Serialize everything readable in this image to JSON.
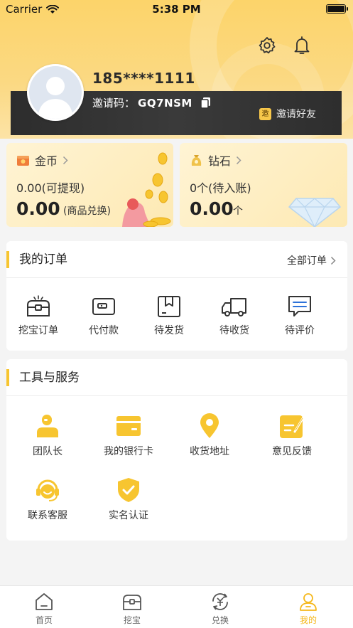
{
  "status_bar": {
    "carrier": "Carrier",
    "time": "5:38 PM"
  },
  "profile": {
    "phone": "185****1111",
    "invite_code_label": "邀请码：",
    "invite_code": "GQ7NSM",
    "invite_friends_badge": "邀",
    "invite_friends": "邀请好友"
  },
  "wallet": {
    "coins": {
      "title": "金币",
      "withdrawable": "0.00(可提现)",
      "amount": "0.00",
      "note": "(商品兑换)"
    },
    "diamonds": {
      "title": "钻石",
      "pending": "0个(待入账)",
      "amount": "0.00",
      "unit": "个"
    }
  },
  "orders": {
    "title": "我的订单",
    "all_label": "全部订单",
    "items": [
      {
        "label": "挖宝订单",
        "icon": "treasure-box-icon"
      },
      {
        "label": "代付款",
        "icon": "wallet-icon"
      },
      {
        "label": "待发货",
        "icon": "package-icon"
      },
      {
        "label": "待收货",
        "icon": "truck-icon"
      },
      {
        "label": "待评价",
        "icon": "comment-icon"
      }
    ]
  },
  "tools": {
    "title": "工具与服务",
    "items": [
      {
        "label": "团队长",
        "icon": "team-leader-icon"
      },
      {
        "label": "我的银行卡",
        "icon": "bank-card-icon"
      },
      {
        "label": "收货地址",
        "icon": "location-pin-icon"
      },
      {
        "label": "意见反馈",
        "icon": "feedback-icon"
      },
      {
        "label": "联系客服",
        "icon": "customer-service-icon"
      },
      {
        "label": "实名认证",
        "icon": "verified-shield-icon"
      }
    ]
  },
  "tabbar": {
    "items": [
      {
        "label": "首页",
        "icon": "home-icon"
      },
      {
        "label": "挖宝",
        "icon": "treasure-icon"
      },
      {
        "label": "兑换",
        "icon": "exchange-icon"
      },
      {
        "label": "我的",
        "icon": "user-icon"
      }
    ],
    "active_index": 3
  },
  "colors": {
    "accent": "#f7c530",
    "active_tab": "#f5b81c",
    "header": "#fcd46a",
    "dark_bar": "#333333"
  }
}
